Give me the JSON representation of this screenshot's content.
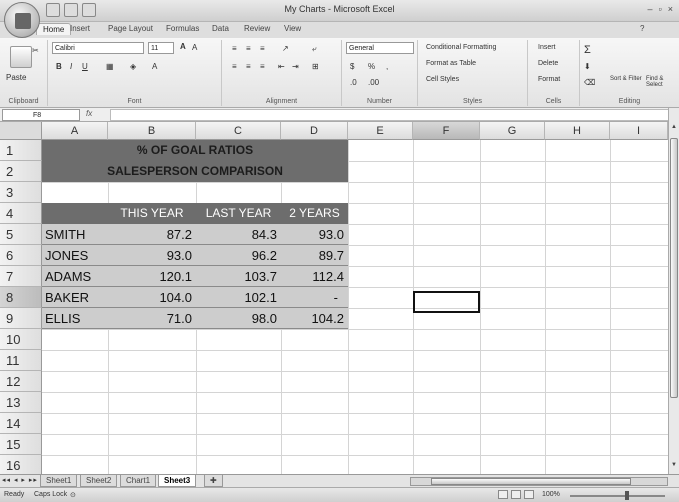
{
  "window": {
    "title": "My Charts - Microsoft Excel"
  },
  "ribbon": {
    "tabs": [
      "Home",
      "Insert",
      "Page Layout",
      "Formulas",
      "Data",
      "Review",
      "View"
    ],
    "active_tab": "Home",
    "font_name": "Calibri",
    "font_size": "11",
    "number_format": "General",
    "groups": [
      "Clipboard",
      "Font",
      "Alignment",
      "Number",
      "Styles",
      "Cells",
      "Editing"
    ],
    "paste_label": "Paste",
    "conditional_formatting": "Conditional Formatting",
    "format_as_table": "Format as Table",
    "cell_styles": "Cell Styles",
    "insert": "Insert",
    "delete": "Delete",
    "format": "Format",
    "sort_filter": "Sort & Filter",
    "find_select": "Find & Select",
    "sigma": "Σ",
    "dollar": "$",
    "percent": "%"
  },
  "formula_bar": {
    "name_box": "F8",
    "fx": "fx",
    "content": ""
  },
  "sheet": {
    "columns": [
      "A",
      "B",
      "C",
      "D",
      "E",
      "F",
      "G",
      "H",
      "I"
    ],
    "rows": [
      "1",
      "2",
      "3",
      "4",
      "5",
      "6",
      "7",
      "8",
      "9",
      "10",
      "11",
      "12",
      "13",
      "14",
      "15",
      "16"
    ],
    "title1": "% OF GOAL RATIOS",
    "title2": "SALESPERSON COMPARISON",
    "headers": [
      "THIS YEAR",
      "LAST YEAR",
      "2 YEARS"
    ],
    "data": [
      {
        "name": "SMITH",
        "values": [
          "87.2",
          "84.3",
          "93.0"
        ]
      },
      {
        "name": "JONES",
        "values": [
          "93.0",
          "96.2",
          "89.7"
        ]
      },
      {
        "name": "ADAMS",
        "values": [
          "120.1",
          "103.7",
          "112.4"
        ]
      },
      {
        "name": "BAKER",
        "values": [
          "104.0",
          "102.1",
          "-"
        ]
      },
      {
        "name": "ELLIS",
        "values": [
          "71.0",
          "98.0",
          "104.2"
        ]
      }
    ],
    "active_cell": "F8"
  },
  "sheet_tabs": [
    "Sheet1",
    "Sheet2",
    "Chart1",
    "Sheet3"
  ],
  "active_sheet": "Sheet3",
  "status": {
    "ready": "Ready",
    "caps": "Caps Lock",
    "zoom": "100%"
  }
}
